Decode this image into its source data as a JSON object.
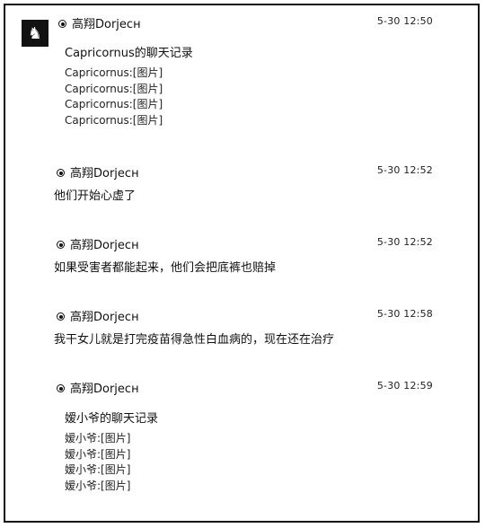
{
  "messages": [
    {
      "sender": "高翔Dorjeсн",
      "time": "5-30 12:50",
      "forward": {
        "title": "Capricornus的聊天记录",
        "lines": [
          "Capricornus:[图片]",
          "Capricornus:[图片]",
          "Capricornus:[图片]",
          "Capricornus:[图片]"
        ]
      }
    },
    {
      "sender": "高翔Dorjeсн",
      "time": "5-30 12:52",
      "text": "他们开始心虚了"
    },
    {
      "sender": "高翔Dorjeсн",
      "time": "5-30 12:52",
      "text": "如果受害者都能起来，他们会把底裤也赔掉"
    },
    {
      "sender": "高翔Dorjeсн",
      "time": "5-30 12:58",
      "text": "我干女儿就是打完疫苗得急性白血病的，现在还在治疗"
    },
    {
      "sender": "高翔Dorjeсн",
      "time": "5-30 12:59",
      "forward": {
        "title": "嫒小爷的聊天记录",
        "lines": [
          "嫒小爷:[图片]",
          "嫒小爷:[图片]",
          "嫒小爷:[图片]",
          "嫒小爷:[图片]"
        ]
      }
    }
  ],
  "icons": {
    "avatar": "avatar-icon",
    "sender_badge": "sender-badge-icon"
  }
}
